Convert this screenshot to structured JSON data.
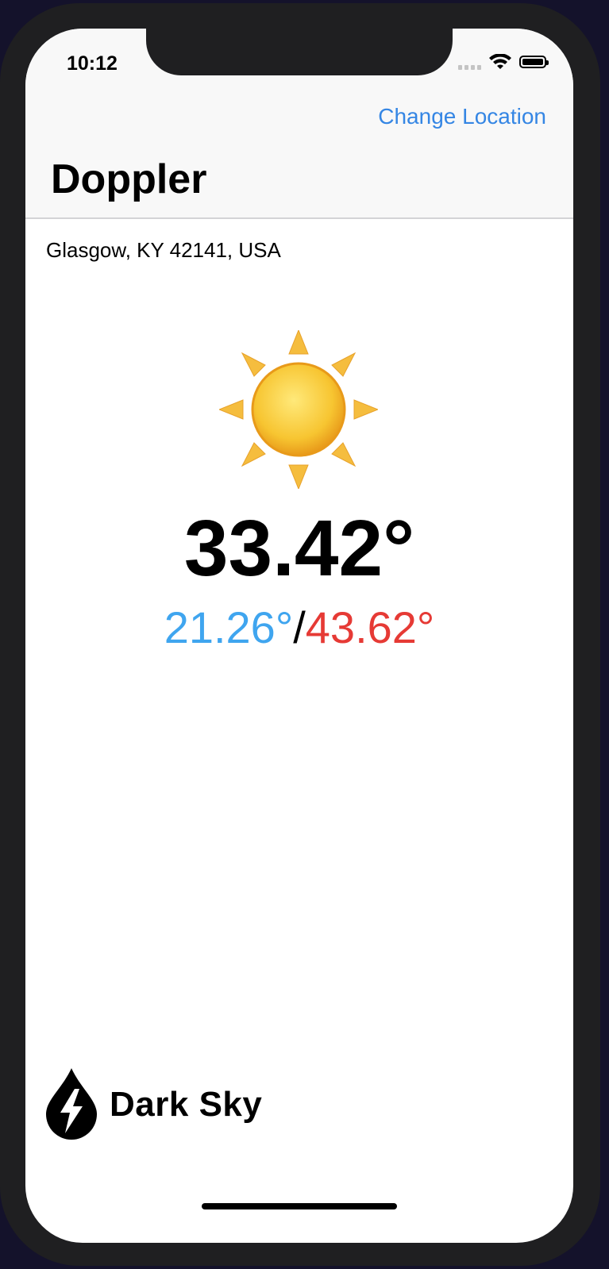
{
  "status_bar": {
    "time": "10:12"
  },
  "nav": {
    "change_location_label": "Change Location",
    "title": "Doppler"
  },
  "weather": {
    "location": "Glasgow, KY 42141, USA",
    "condition_icon": "sun-icon",
    "current_temp": "33.42°",
    "low_temp": "21.26°",
    "separator": "/",
    "high_temp": "43.62°"
  },
  "branding": {
    "name": "Dark Sky",
    "icon": "dark-sky-logo-icon"
  },
  "colors": {
    "accent": "#3586e4",
    "low": "#3fa5ef",
    "high": "#e63a35"
  }
}
